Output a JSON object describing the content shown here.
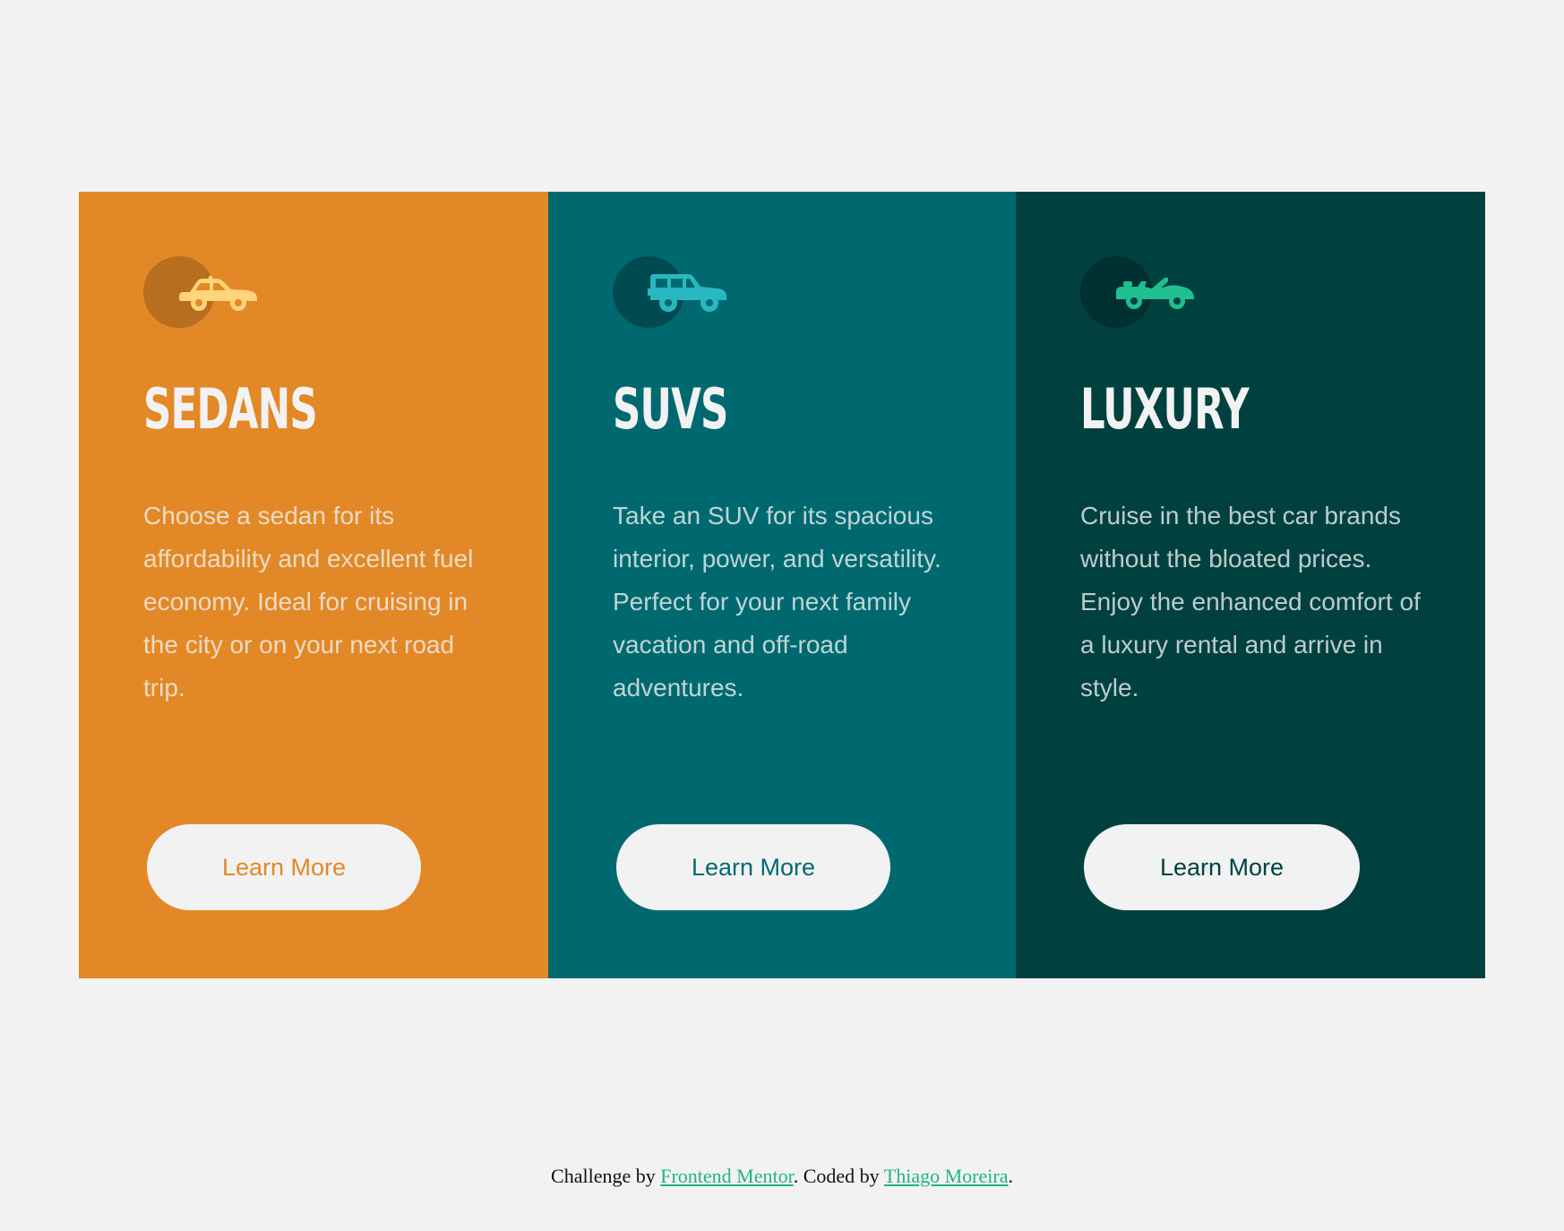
{
  "cards": [
    {
      "title": "Sedans",
      "icon": "sedan-car-icon",
      "text": "Choose a sedan for its affordability and excellent fuel economy. Ideal for cruising in the city or on your next road trip.",
      "button_label": "Learn More",
      "background_color": "#e38826",
      "icon_color": "#ffd47a"
    },
    {
      "title": "SUVs",
      "icon": "suv-car-icon",
      "text": "Take an SUV for its spacious interior, power, and versatility. Perfect for your next family vacation and off-road adventures.",
      "button_label": "Learn More",
      "background_color": "#006970",
      "icon_color": "#2ab8c0"
    },
    {
      "title": "Luxury",
      "icon": "luxury-convertible-icon",
      "text": "Cruise in the best car brands without the bloated prices. Enjoy the enhanced comfort of a luxury rental and arrive in style.",
      "button_label": "Learn More",
      "background_color": "#004140",
      "icon_color": "#1fbf8f"
    }
  ],
  "attribution": {
    "prefix": "Challenge by ",
    "link1": "Frontend Mentor",
    "middle": ". Coded by ",
    "link2": "Thiago Moreira",
    "suffix": "."
  }
}
